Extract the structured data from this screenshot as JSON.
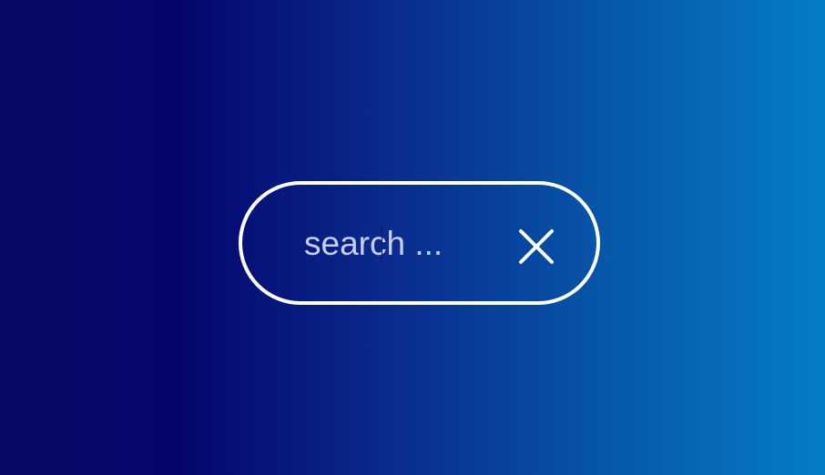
{
  "search": {
    "placeholder": "search ...",
    "value": ""
  },
  "clear_button": {
    "icon": "close-icon"
  },
  "colors": {
    "background_left": "#060a63",
    "background_right": "#057cc8",
    "border": "#ffffff",
    "placeholder_text": "#c9cdf0"
  }
}
